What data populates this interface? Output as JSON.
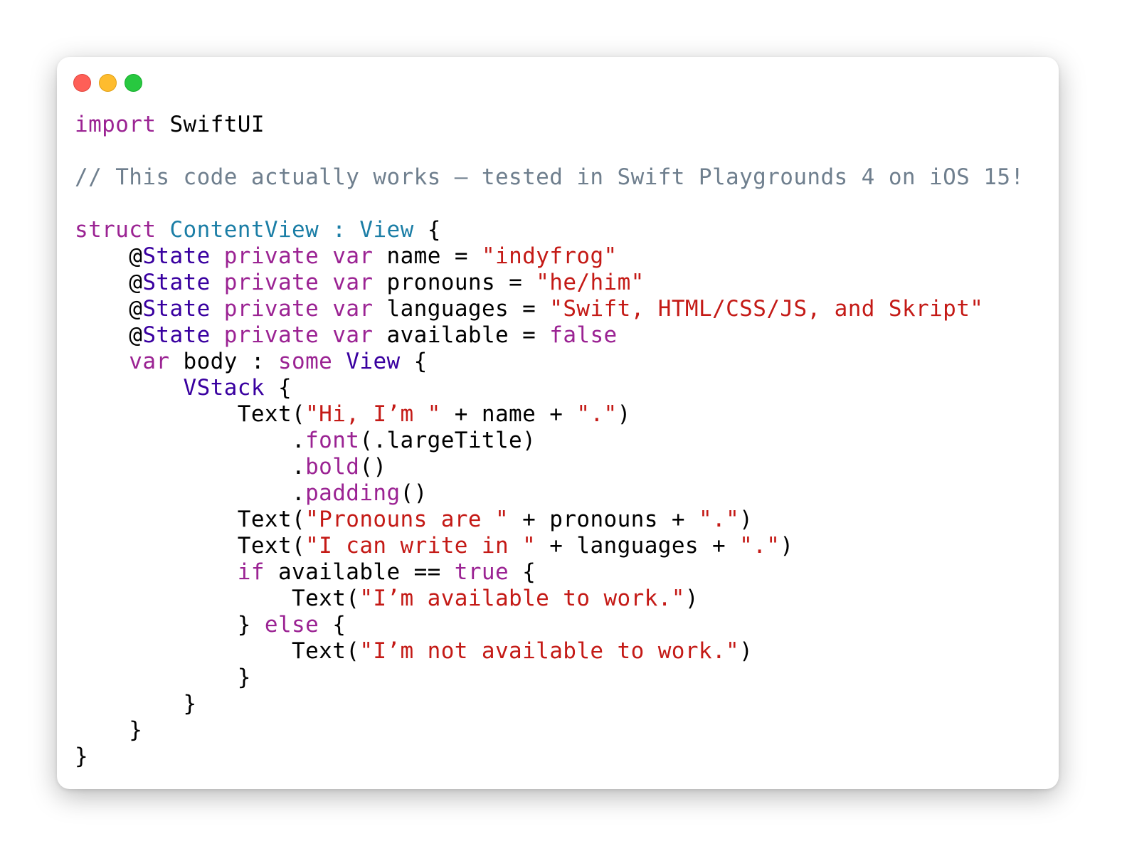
{
  "window": {
    "buttons": {
      "close": "close-button",
      "minimize": "minimize-button",
      "zoom": "zoom-button"
    }
  },
  "colors": {
    "keyword": "#9b2393",
    "type": "#3900a0",
    "declared_type": "#1b7ea6",
    "string": "#c41a16",
    "comment": "#6f7f8e",
    "plain": "#000000"
  },
  "code": {
    "lines": [
      [
        {
          "t": "import",
          "k": "kw"
        },
        {
          "t": " SwiftUI",
          "k": "p"
        }
      ],
      [],
      [
        {
          "t": "// This code actually works – tested in Swift Playgrounds 4 on iOS 15!",
          "k": "cmt"
        }
      ],
      [],
      [
        {
          "t": "struct",
          "k": "kw"
        },
        {
          "t": " ",
          "k": "p"
        },
        {
          "t": "ContentView",
          "k": "tyd"
        },
        {
          "t": " : ",
          "k": "tyd"
        },
        {
          "t": "View",
          "k": "tyd"
        },
        {
          "t": " {",
          "k": "p"
        }
      ],
      [
        {
          "t": "    @",
          "k": "p"
        },
        {
          "t": "State",
          "k": "tyl"
        },
        {
          "t": " ",
          "k": "p"
        },
        {
          "t": "private",
          "k": "kw"
        },
        {
          "t": " ",
          "k": "p"
        },
        {
          "t": "var",
          "k": "kw"
        },
        {
          "t": " name = ",
          "k": "p"
        },
        {
          "t": "\"indyfrog\"",
          "k": "str"
        }
      ],
      [
        {
          "t": "    @",
          "k": "p"
        },
        {
          "t": "State",
          "k": "tyl"
        },
        {
          "t": " ",
          "k": "p"
        },
        {
          "t": "private",
          "k": "kw"
        },
        {
          "t": " ",
          "k": "p"
        },
        {
          "t": "var",
          "k": "kw"
        },
        {
          "t": " pronouns = ",
          "k": "p"
        },
        {
          "t": "\"he/him\"",
          "k": "str"
        }
      ],
      [
        {
          "t": "    @",
          "k": "p"
        },
        {
          "t": "State",
          "k": "tyl"
        },
        {
          "t": " ",
          "k": "p"
        },
        {
          "t": "private",
          "k": "kw"
        },
        {
          "t": " ",
          "k": "p"
        },
        {
          "t": "var",
          "k": "kw"
        },
        {
          "t": " languages = ",
          "k": "p"
        },
        {
          "t": "\"Swift, HTML/CSS/JS, and Skript\"",
          "k": "str"
        }
      ],
      [
        {
          "t": "    @",
          "k": "p"
        },
        {
          "t": "State",
          "k": "tyl"
        },
        {
          "t": " ",
          "k": "p"
        },
        {
          "t": "private",
          "k": "kw"
        },
        {
          "t": " ",
          "k": "p"
        },
        {
          "t": "var",
          "k": "kw"
        },
        {
          "t": " available = ",
          "k": "p"
        },
        {
          "t": "false",
          "k": "kw"
        }
      ],
      [
        {
          "t": "    ",
          "k": "p"
        },
        {
          "t": "var",
          "k": "kw"
        },
        {
          "t": " body : ",
          "k": "p"
        },
        {
          "t": "some",
          "k": "kw"
        },
        {
          "t": " ",
          "k": "p"
        },
        {
          "t": "View",
          "k": "tyl"
        },
        {
          "t": " {",
          "k": "p"
        }
      ],
      [
        {
          "t": "        ",
          "k": "p"
        },
        {
          "t": "VStack",
          "k": "tyl"
        },
        {
          "t": " {",
          "k": "p"
        }
      ],
      [
        {
          "t": "            Text(",
          "k": "p"
        },
        {
          "t": "\"Hi, I’m \"",
          "k": "str"
        },
        {
          "t": " + name + ",
          "k": "p"
        },
        {
          "t": "\".\"",
          "k": "str"
        },
        {
          "t": ")",
          "k": "p"
        }
      ],
      [
        {
          "t": "                .",
          "k": "p"
        },
        {
          "t": "font",
          "k": "kw"
        },
        {
          "t": "(.largeTitle)",
          "k": "p"
        }
      ],
      [
        {
          "t": "                .",
          "k": "p"
        },
        {
          "t": "bold",
          "k": "kw"
        },
        {
          "t": "()",
          "k": "p"
        }
      ],
      [
        {
          "t": "                .",
          "k": "p"
        },
        {
          "t": "padding",
          "k": "kw"
        },
        {
          "t": "()",
          "k": "p"
        }
      ],
      [
        {
          "t": "            Text(",
          "k": "p"
        },
        {
          "t": "\"Pronouns are \"",
          "k": "str"
        },
        {
          "t": " + pronouns + ",
          "k": "p"
        },
        {
          "t": "\".\"",
          "k": "str"
        },
        {
          "t": ")",
          "k": "p"
        }
      ],
      [
        {
          "t": "            Text(",
          "k": "p"
        },
        {
          "t": "\"I can write in \"",
          "k": "str"
        },
        {
          "t": " + languages + ",
          "k": "p"
        },
        {
          "t": "\".\"",
          "k": "str"
        },
        {
          "t": ")",
          "k": "p"
        }
      ],
      [
        {
          "t": "            ",
          "k": "p"
        },
        {
          "t": "if",
          "k": "kw"
        },
        {
          "t": " available == ",
          "k": "p"
        },
        {
          "t": "true",
          "k": "kw"
        },
        {
          "t": " {",
          "k": "p"
        }
      ],
      [
        {
          "t": "                Text(",
          "k": "p"
        },
        {
          "t": "\"I’m available to work.\"",
          "k": "str"
        },
        {
          "t": ")",
          "k": "p"
        }
      ],
      [
        {
          "t": "            } ",
          "k": "p"
        },
        {
          "t": "else",
          "k": "kw"
        },
        {
          "t": " {",
          "k": "p"
        }
      ],
      [
        {
          "t": "                Text(",
          "k": "p"
        },
        {
          "t": "\"I’m not available to work.\"",
          "k": "str"
        },
        {
          "t": ")",
          "k": "p"
        }
      ],
      [
        {
          "t": "            }",
          "k": "p"
        }
      ],
      [
        {
          "t": "        }",
          "k": "p"
        }
      ],
      [
        {
          "t": "    }",
          "k": "p"
        }
      ],
      [
        {
          "t": "}",
          "k": "p"
        }
      ]
    ]
  }
}
